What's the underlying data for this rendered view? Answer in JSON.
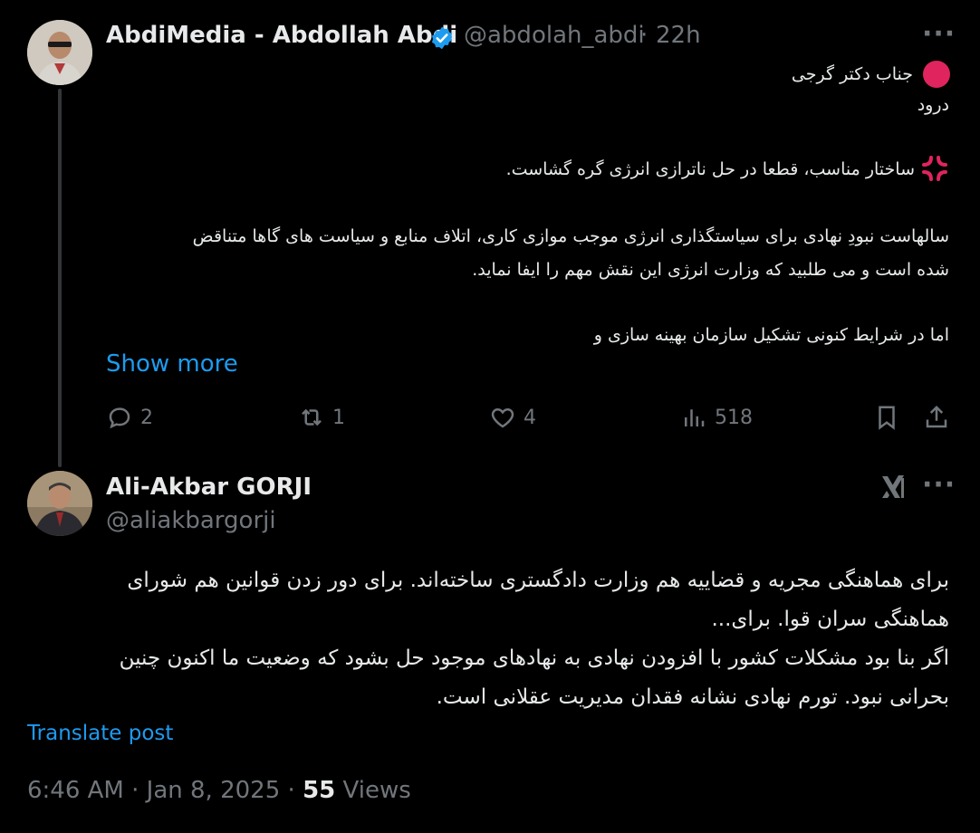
{
  "tweet1": {
    "author_name": "AbdiMedia - Abdollah Abdi",
    "handle": "@abdolah_abdi",
    "separator": "·",
    "time": "22h",
    "lines": [
      "جناب دکتر گرجی",
      "درود",
      "ساختار مناسب، قطعا در حل ناترازی انرژی گره گشاست.",
      "سالهاست نبودِ نهادی برای سیاستگذاری انرژی موجب موازی کاری، اتلاف منابع و سیاست های گاها متناقض",
      "شده است و می طلبید که وزارت انرژی این نقش مهم را ایفا نماید.",
      "اما در شرایط کنونی تشکیل سازمان بهینه سازی و"
    ],
    "show_more": "Show more",
    "actions": {
      "replies": "2",
      "reposts": "1",
      "likes": "4",
      "views": "518"
    }
  },
  "tweet2": {
    "author_name": "Ali-Akbar GORJI",
    "handle": "@aliakbargorji",
    "lines": [
      "برای هماهنگی مجریه و قضاییه هم وزارت دادگستری ساخته‌اند. برای دور زدن قوانین هم شورای",
      "هماهنگی سران قوا. برای...",
      "اگر بنا بود مشکلات کشور با افزودن نهادی به نهادهای موجود حل بشود که وضعیت ما اکنون چنین",
      "بحرانی نبود. تورم نهادی نشانه فقدان مدیریت عقلانی است."
    ],
    "translate": "Translate post",
    "time": "6:46 AM",
    "separator": "·",
    "date": "Jan 8, 2025",
    "views_count": "55",
    "views_label": "Views"
  },
  "colors": {
    "background": "#000000",
    "text": "#e7e9ea",
    "muted": "#71767b",
    "link": "#1d9bf0",
    "red_circle": "#e0245e"
  },
  "icons": [
    "more-icon",
    "verified-badge-icon",
    "red-circle-emoji",
    "anger-symbol-emoji",
    "reply-icon",
    "repost-icon",
    "like-icon",
    "views-icon",
    "bookmark-icon",
    "share-icon",
    "grok-icon"
  ]
}
